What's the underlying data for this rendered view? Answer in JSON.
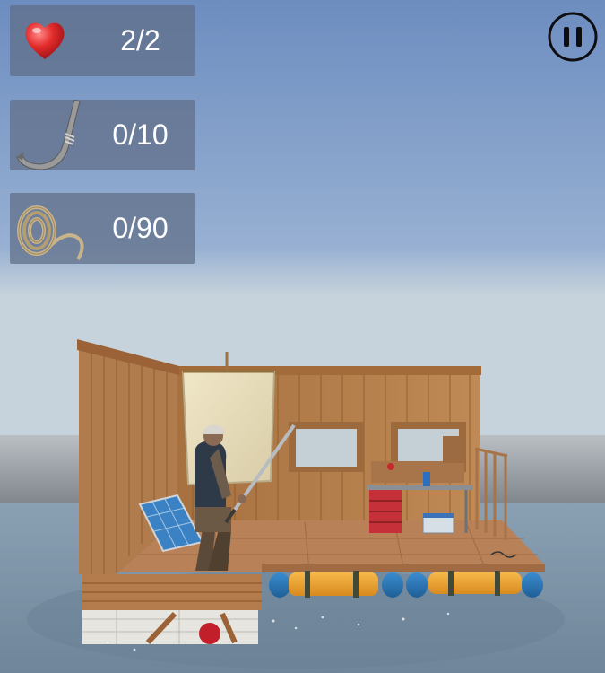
{
  "hud": {
    "health": {
      "icon": "heart-icon",
      "value": "2/2",
      "color": "#e32b2b"
    },
    "hooks": {
      "icon": "fishing-hook-icon",
      "value": "0/10"
    },
    "rope": {
      "icon": "rope-coil-icon",
      "value": "0/90"
    }
  },
  "controls": {
    "pause_icon": "pause-icon"
  },
  "colors": {
    "sky_top": "#6d8dc0",
    "sky_horizon": "#c7d3dc",
    "water": "#7f94a8",
    "wood": "#b07c4d",
    "buoy_orange": "#f0a030",
    "buoy_blue": "#2a78b8"
  }
}
